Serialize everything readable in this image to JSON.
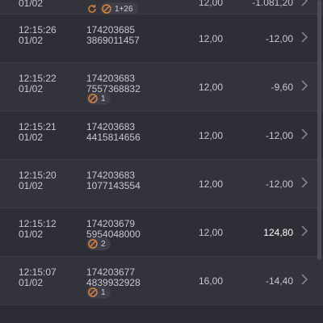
{
  "rows": [
    {
      "time": "",
      "date": "01/02",
      "id1": "",
      "id2": "",
      "amount": "12,00",
      "delta": "-1.081,20",
      "badge": "1+26",
      "top": true
    },
    {
      "time": "12:15:26",
      "date": "01/02",
      "id1": "174203685",
      "id2": "3869011457",
      "amount": "12,00",
      "delta": "-12,00"
    },
    {
      "time": "12:15:22",
      "date": "01/02",
      "id1": "174203683",
      "id2": "7557368832",
      "amount": "12,00",
      "delta": "-9,60",
      "badge": "1"
    },
    {
      "time": "12:15:21",
      "date": "01/02",
      "id1": "174203683",
      "id2": "4415814656",
      "amount": "12,00",
      "delta": "-12,00"
    },
    {
      "time": "12:15:20",
      "date": "01/02",
      "id1": "174203683",
      "id2": "1077143554",
      "amount": "12,00",
      "delta": "-12,00"
    },
    {
      "time": "12:15:12",
      "date": "01/02",
      "id1": "174203679",
      "id2": "5954048000",
      "amount": "12,00",
      "delta": "124,80",
      "badge": "2",
      "positive": true
    },
    {
      "time": "12:15:07",
      "date": "01/02",
      "id1": "174203677",
      "id2": "4839932928",
      "amount": "16,00",
      "delta": "-14,40",
      "badge": "1"
    }
  ],
  "colors": {
    "background": "#2b2b33",
    "positive": "#ffffff",
    "badge_icon": "#d9823b"
  },
  "icons": {
    "badge": "orange-circle-slash-icon",
    "chevron": "chevron-right-icon",
    "refresh": "refresh-icon"
  }
}
